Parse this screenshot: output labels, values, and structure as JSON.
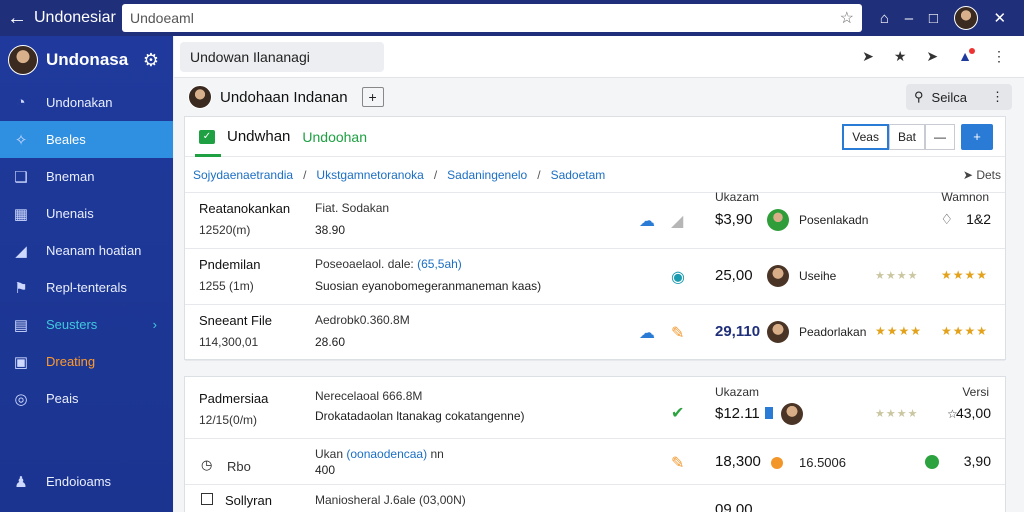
{
  "topbar": {
    "back_icon": "arrow-left-icon",
    "app_title": "Undonesiar",
    "address_value": "Undoeaml",
    "star_icon": "star-icon"
  },
  "sidebar": {
    "profile_name": "Undonasa",
    "items": [
      {
        "label": "Undonakan",
        "icon": "dashboard-icon"
      },
      {
        "label": "Beales",
        "icon": "share-icon"
      },
      {
        "label": "Bneman",
        "icon": "folder-icon"
      },
      {
        "label": "Unenais",
        "icon": "list-icon"
      },
      {
        "label": "Neanam hoatian",
        "icon": "tag-icon"
      },
      {
        "label": "Repl-tenterals",
        "icon": "flag-icon"
      },
      {
        "label": "Seusters",
        "icon": "server-icon"
      },
      {
        "label": "Dreating",
        "icon": "bag-icon"
      },
      {
        "label": "Peais",
        "icon": "settings-icon"
      },
      {
        "label": "Endoioams",
        "icon": "users-icon"
      }
    ]
  },
  "tabbar": {
    "tab_label": "Undowan Ilananagi"
  },
  "header": {
    "title": "Undohaan Indanan",
    "plus": "+",
    "search_label": "Seilca"
  },
  "card1": {
    "title": "Undwhan",
    "subtitle": "Undoohan",
    "buttons": [
      "Veas",
      "Bat",
      "—"
    ],
    "blue_button": "+",
    "breadcrumbs": [
      "Sojydaenaetrandia",
      "Ukstgamnetoranoka",
      "Sadaningenelo",
      "Sadoetam"
    ],
    "crumb_right": "Dets",
    "rows": [
      {
        "name": "Reatanokankan",
        "sub": "12520(m)",
        "desc1": "Fiat. Sodakan",
        "desc1_blue": "",
        "desc2": "38.90",
        "price_label": "Ukazam",
        "price": "$3,90",
        "person": "Posenlakadn",
        "stars_grey": "",
        "stars_gold": "",
        "right_label": "Wamnon",
        "right_value": "1&2"
      },
      {
        "name": "Pndemilan",
        "sub": "1255 (1m)",
        "desc1": "Poseoaelaol. dale:",
        "desc1_blue": "(65,5ah)",
        "desc2": "Suosian eyanobomegeranmaneman kaas)",
        "price_label": "",
        "price": "25,00",
        "person": "Useihe",
        "stars_grey": "★★★★",
        "stars_gold": "★★★★",
        "right_label": "",
        "right_value": ""
      },
      {
        "name": "Sneeant File",
        "sub": "114,300,01",
        "desc1": "Aedrobk0.360.8M",
        "desc1_blue": "",
        "desc2": "28.60",
        "price_label": "",
        "price": "29,110",
        "person": "Peadorlakan",
        "stars_grey": "★★★★",
        "stars_gold": "★★★★",
        "right_label": "",
        "right_value": ""
      }
    ]
  },
  "card2": {
    "rows": [
      {
        "name": "Padmersiaa",
        "sub": "12/15(0/m)",
        "desc1": "Nerecelaoal 666.8M",
        "desc2": "Drokatadaolan ltanakag cokatangenne)",
        "price_label": "Ukazam",
        "price": "$12.11",
        "stars_grey": "★★★★",
        "right_label": "Versi",
        "right_value": "43,00"
      },
      {
        "name": "Rbo",
        "desc1": "Ukan",
        "desc1_blue": "(oonaodencaa)",
        "desc1_tail": "nn",
        "desc2": "400",
        "price": "18,300",
        "person_value": "16.5006",
        "right_value": "3,90"
      },
      {
        "name": "Sollyran",
        "desc1": "Maniosheral J.6ale (03,00N)",
        "price": "09,00"
      }
    ]
  },
  "colors": {
    "topbar": "#1f2f7a",
    "sidebar": "#1f3a9c",
    "accent_blue": "#2a7bd6",
    "accent_green": "#1ea043",
    "star_gold": "#e2a21c"
  }
}
